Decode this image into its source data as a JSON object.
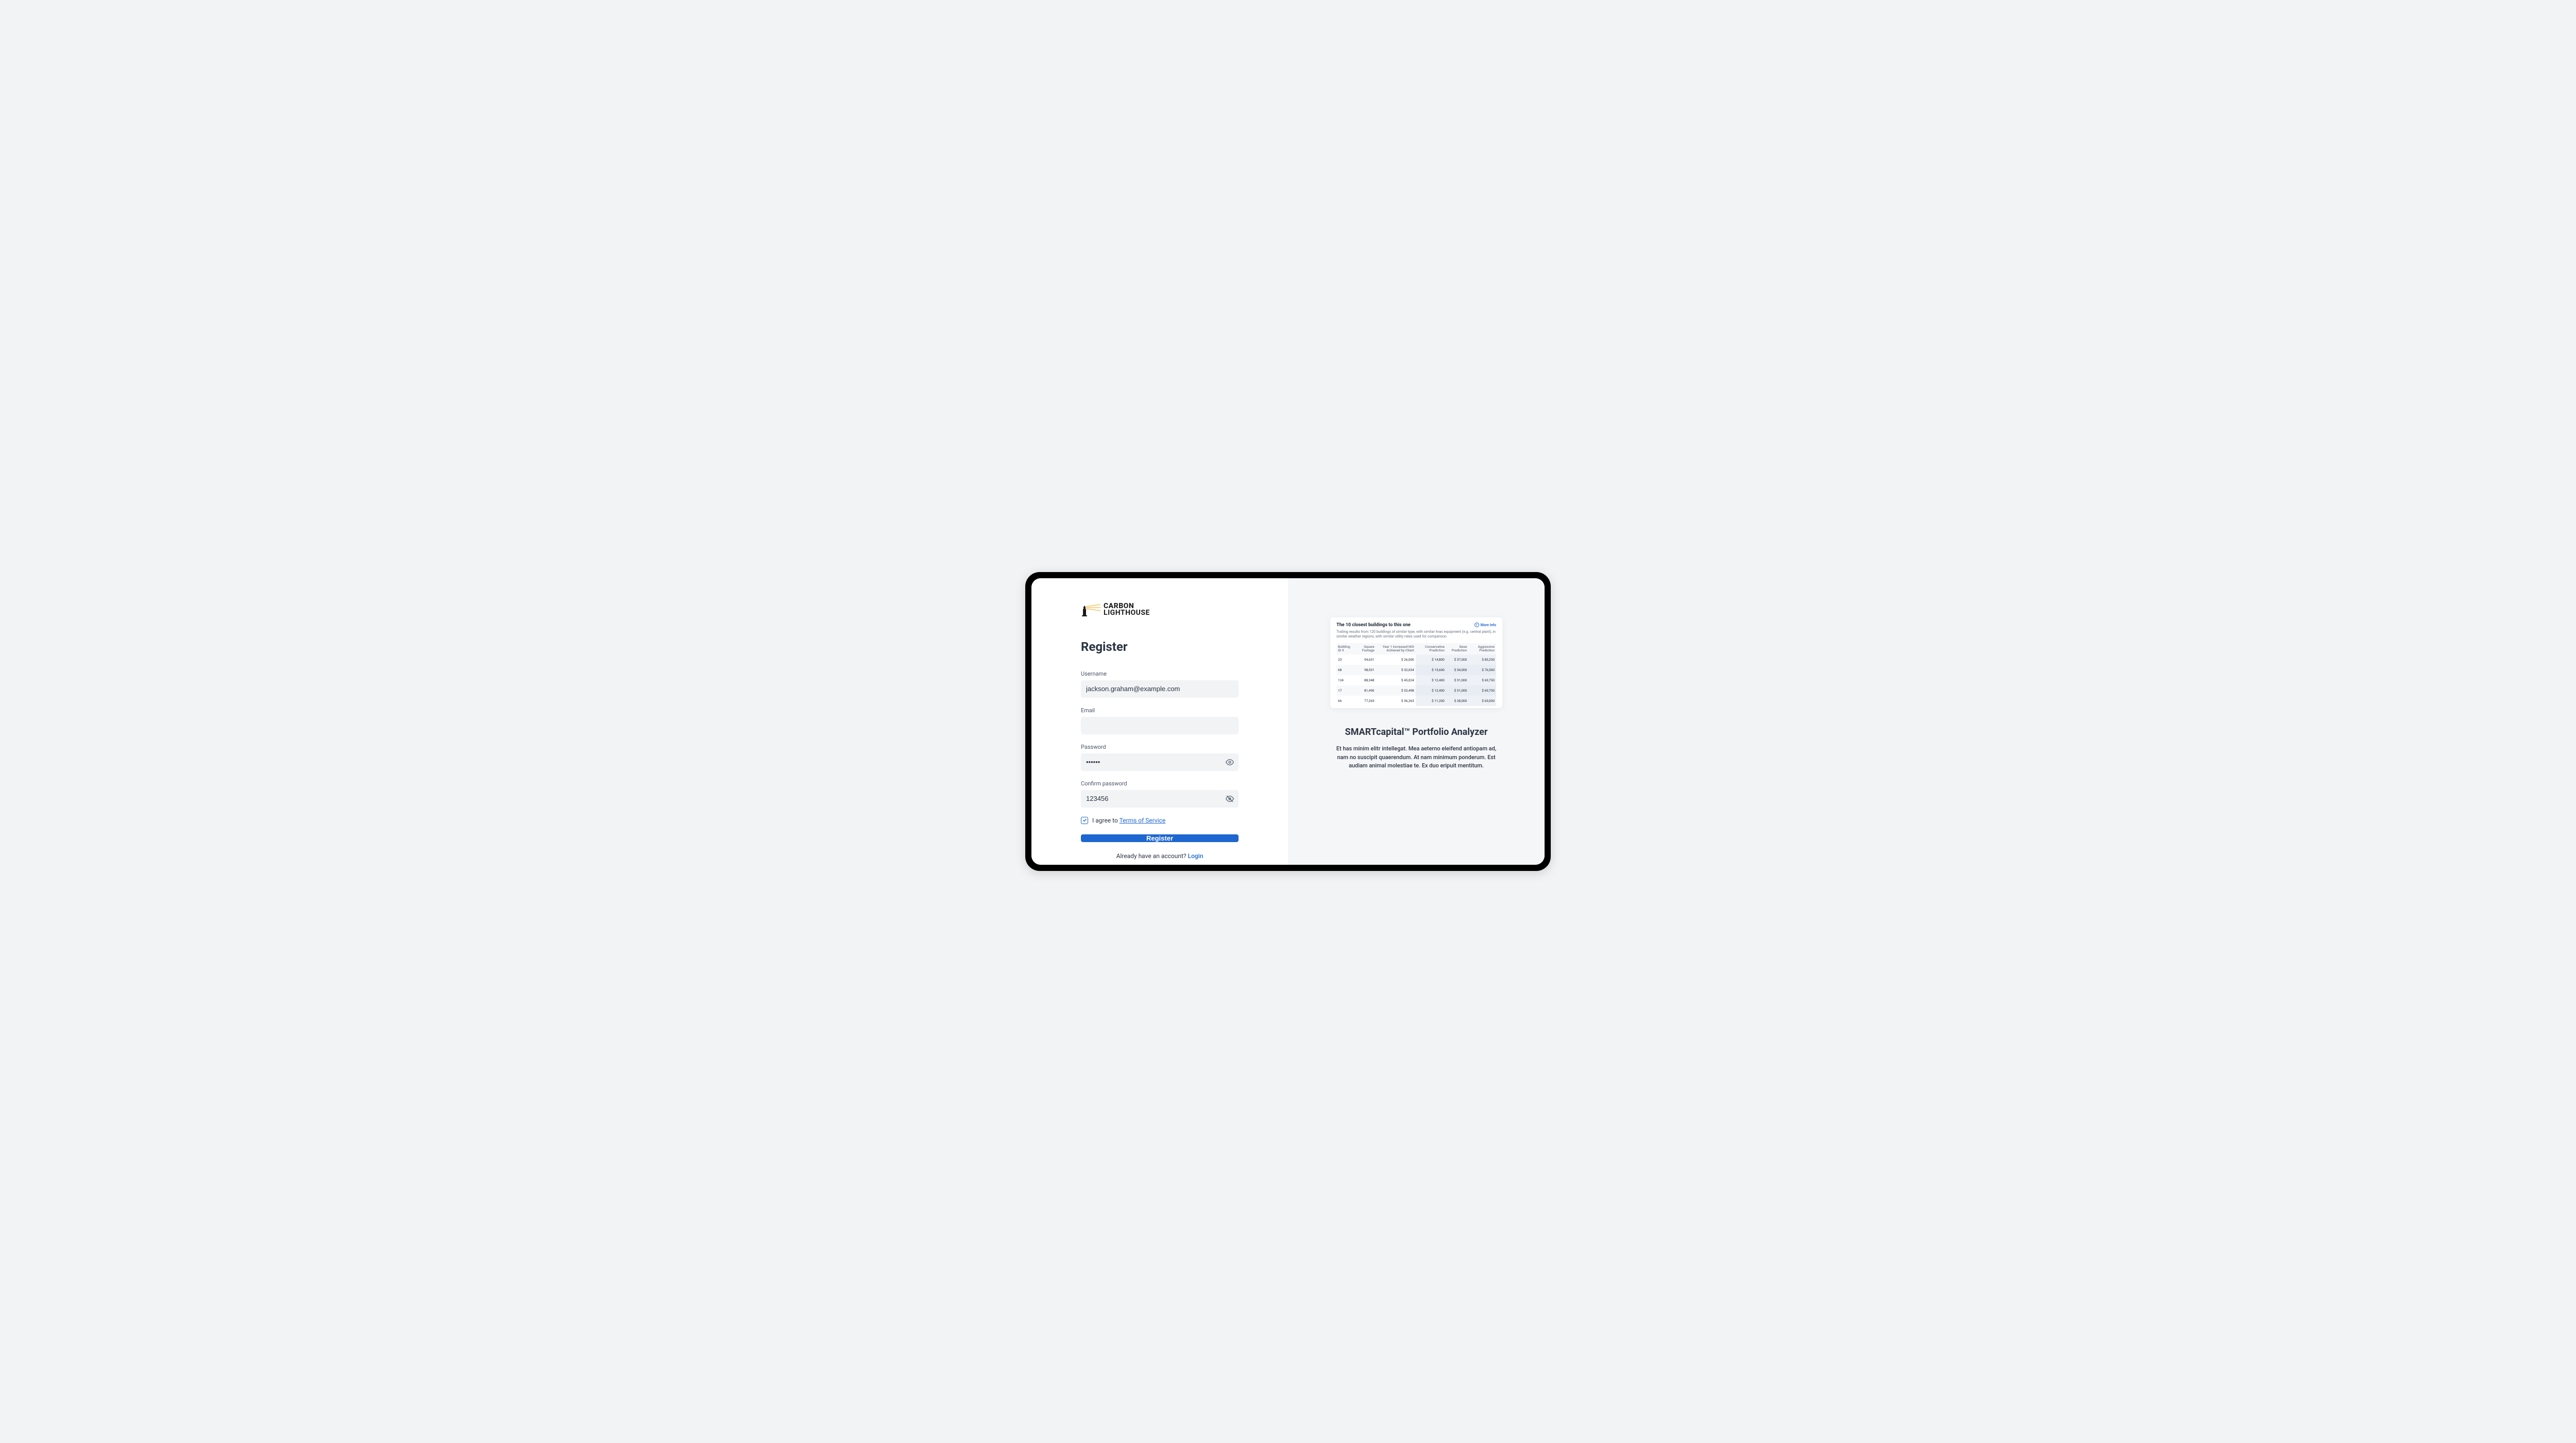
{
  "brand": {
    "line1": "CARBON",
    "line2": "LIGHTHOUSE"
  },
  "form": {
    "title": "Register",
    "username_label": "Username",
    "username_value": "jackson.graham@example.com",
    "email_label": "Email",
    "email_value": "",
    "password_label": "Password",
    "password_value": "••••••",
    "confirm_label": "Confirm password",
    "confirm_value": "123456",
    "terms_prefix": "I agree to ",
    "terms_link": "Terms of  Service",
    "submit_label": "Register",
    "login_prefix": "Already have an account? ",
    "login_link": "Login"
  },
  "preview": {
    "title": "The 10 closest buildings to this one",
    "more_info": "More Info",
    "subtitle": "Trailing results from 120 buildings of similar type, with similar hvac equipment (e.g. central plant), in similar weather regions, with similar utility rates used for comparison",
    "columns": [
      "Building ID #",
      "Square Footage",
      "Year 1 Increased NOI Achieved by Client",
      "Conservative Prediction",
      "Base Prediction",
      "Aggressive Prediction"
    ],
    "rows": [
      {
        "id": "23",
        "sqft": "94,631",
        "noi": "$ 26,000",
        "cons": "$ 14,800",
        "base": "$ 37,000",
        "aggr": "$ 83,250"
      },
      {
        "id": "68",
        "sqft": "98,531",
        "noi": "$ 32,034",
        "cons": "$ 13,600",
        "base": "$ 34,000",
        "aggr": "$ 76,500"
      },
      {
        "id": "124",
        "sqft": "88,348",
        "noi": "$ 45,024",
        "cons": "$ 12,400",
        "base": "$ 31,000",
        "aggr": "$ 69,750"
      },
      {
        "id": "17",
        "sqft": "81,490",
        "noi": "$ 52,498",
        "cons": "$ 12,400",
        "base": "$ 31,000",
        "aggr": "$ 69,750"
      },
      {
        "id": "66",
        "sqft": "77,263",
        "noi": "$ 36,263",
        "cons": "$ 11,200",
        "base": "$ 28,000",
        "aggr": "$ 63,000"
      }
    ]
  },
  "promo": {
    "title": "SMARTcapital™ Portfolio Analyzer",
    "text": "Et has minim elitr intellegat. Mea aeterno eleifend antiopam ad, nam no suscipit quaerendum. At nam minimum ponderum. Est audiam animal molestiae te. Ex duo eripuit mentitum."
  }
}
